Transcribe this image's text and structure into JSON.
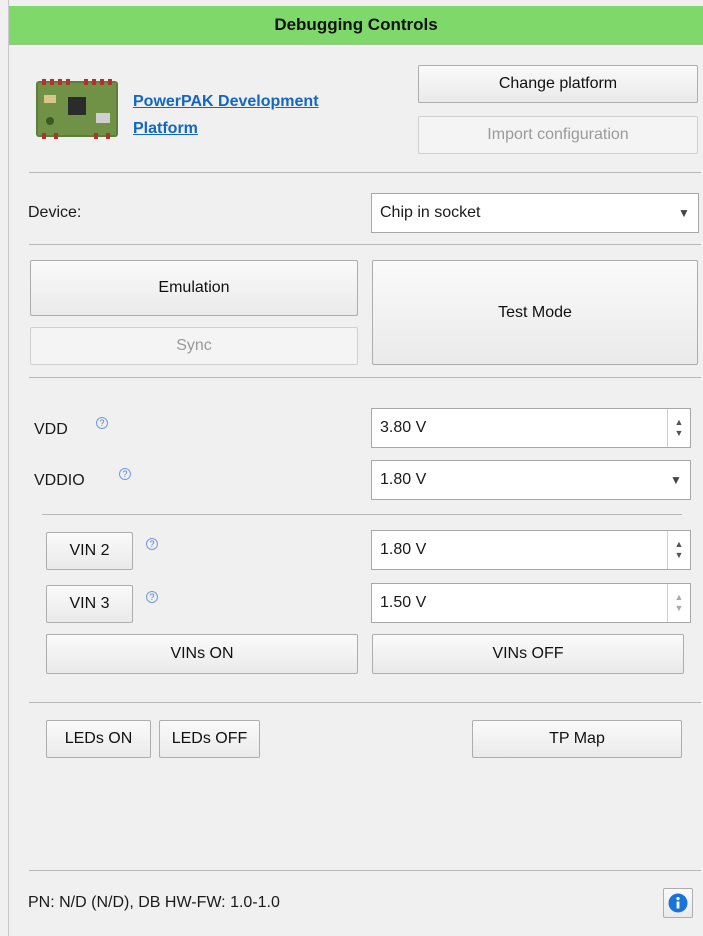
{
  "header": {
    "title": "Debugging Controls"
  },
  "platform": {
    "link_line1": "PowerPAK Development",
    "link_line2": "Platform",
    "change_label": "Change platform",
    "import_label": "Import configuration"
  },
  "device": {
    "label": "Device:",
    "value": "Chip in socket"
  },
  "modes": {
    "emulation_label": "Emulation",
    "sync_label": "Sync",
    "test_mode_label": "Test Mode"
  },
  "power": {
    "vdd_label": "VDD",
    "vdd_value": "3.80 V",
    "vddio_label": "VDDIO",
    "vddio_value": "1.80 V",
    "help_glyph": "?"
  },
  "vins": {
    "vin2_label": "VIN 2",
    "vin2_value": "1.80 V",
    "vin3_label": "VIN 3",
    "vin3_value": "1.50 V",
    "on_label": "VINs ON",
    "off_label": "VINs OFF"
  },
  "leds": {
    "on_label": "LEDs ON",
    "off_label": "LEDs OFF",
    "tp_map_label": "TP Map"
  },
  "footer": {
    "status": "PN: N/D (N/D), DB HW-FW: 1.0-1.0",
    "info_icon": "info-icon"
  },
  "colors": {
    "header_bg": "#7fd86a",
    "link": "#1266c4",
    "info_blue": "#1a73d9"
  }
}
